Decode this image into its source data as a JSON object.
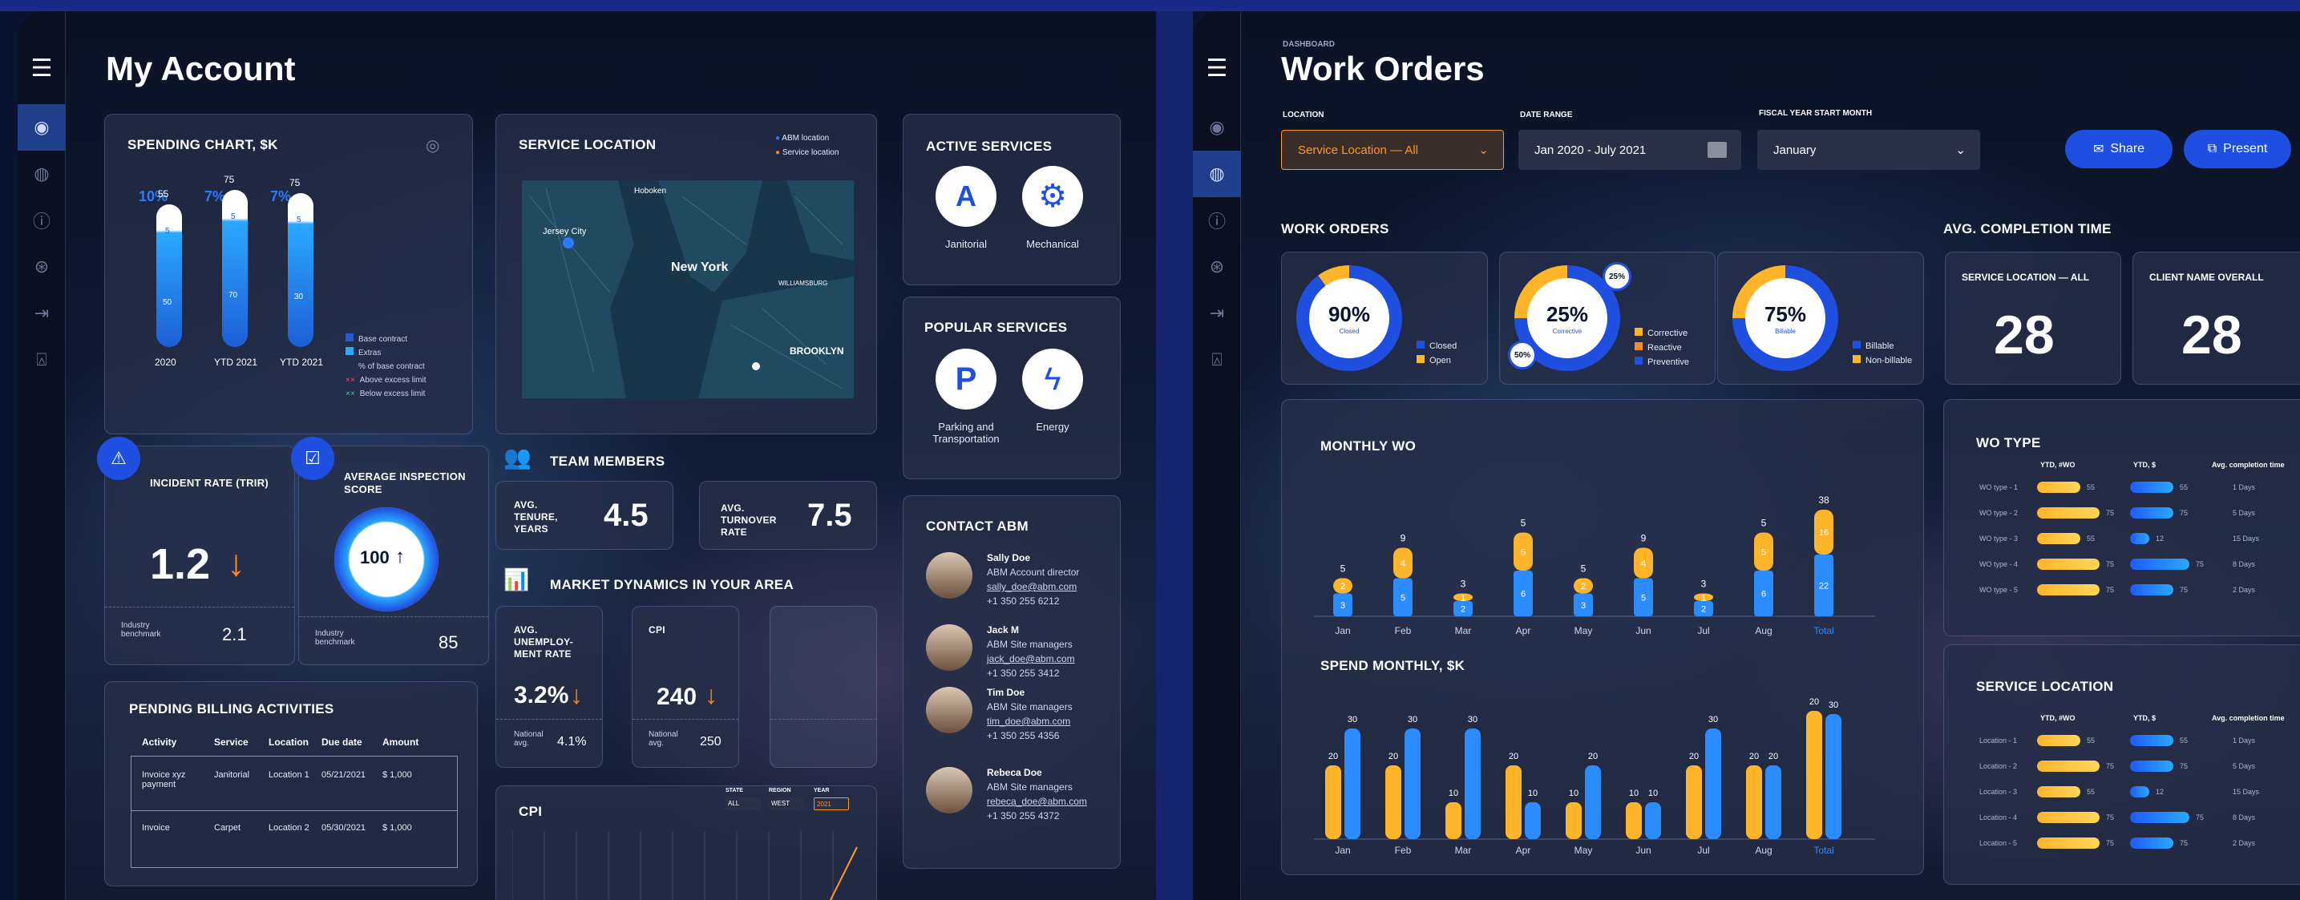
{
  "account": {
    "title": "My Account",
    "spending": {
      "title": "SPENDING CHART, $K",
      "pcts": [
        "10%",
        "7%",
        "7%"
      ],
      "tops": [
        "55",
        "75",
        "75"
      ],
      "inner": [
        [
          "5",
          "50"
        ],
        [
          "5",
          "70"
        ],
        [
          "5",
          "30"
        ]
      ],
      "xs": [
        "2020",
        "YTD 2021",
        "YTD 2021"
      ],
      "legend": [
        "Base contract",
        "Extras",
        "% of base contract",
        "Above excess limit",
        "Below excess limit"
      ]
    },
    "location": {
      "title": "SERVICE LOCATION",
      "legend": [
        "ABM location",
        "Service location"
      ],
      "map": {
        "labels": [
          "Hoboken",
          "Jersey City",
          "New York",
          "BROOKLYN",
          "WILLIAMSBURG"
        ]
      }
    },
    "active": {
      "title": "ACTIVE SERVICES",
      "items": [
        "Janitorial",
        "Mechanical"
      ]
    },
    "popular": {
      "title": "POPULAR SERVICES",
      "items": [
        "Parking and Transportation",
        "Energy"
      ]
    },
    "contact": {
      "title": "CONTACT ABM",
      "people": [
        {
          "name": "Sally Doe",
          "role": "ABM Account director",
          "email": "sally_doe@abm.com",
          "phone": "+1 350 255 6212"
        },
        {
          "name": "Jack M",
          "role": "ABM Site managers",
          "email": "jack_doe@abm.com",
          "phone": "+1 350 255 3412"
        },
        {
          "name": "Tim Doe",
          "role": "ABM Site managers",
          "email": "tim_doe@abm.com",
          "phone": "+1 350 255 4356"
        },
        {
          "name": "Rebeca Doe",
          "role": "ABM Site managers",
          "email": "rebeca_doe@abm.com",
          "phone": "+1 350 255 4372"
        }
      ]
    },
    "incident": {
      "title": "INCIDENT RATE (TRIR)",
      "value": "1.2",
      "bench_label": "Industry benchmark",
      "bench": "2.1"
    },
    "inspection": {
      "title": "AVERAGE INSPECTION SCORE",
      "value": "100",
      "bench_label": "Industry benchmark",
      "bench": "85"
    },
    "team": {
      "title": "TEAM MEMBERS",
      "tenure_label": "AVG. TENURE, YEARS",
      "tenure": "4.5",
      "turnover_label": "AVG. TURNOVER RATE",
      "turnover": "7.5"
    },
    "market": {
      "title": "MARKET DYNAMICS IN YOUR AREA",
      "unemp_label": "AVG. UNEMPLOY-MENT RATE",
      "unemp": "3.2%",
      "unemp_nat_label": "National avg.",
      "unemp_nat": "4.1%",
      "cpi_label": "CPI",
      "cpi": "240",
      "cpi_nat_label": "National avg.",
      "cpi_nat": "250"
    },
    "billing": {
      "title": "PENDING BILLING ACTIVITIES",
      "headers": [
        "Activity",
        "Service",
        "Location",
        "Due date",
        "Amount"
      ],
      "rows": [
        [
          "Invoice xyz payment",
          "Janitorial",
          "Location 1",
          "05/21/2021",
          "$ 1,000"
        ],
        [
          "Invoice",
          "Carpet",
          "Location 2",
          "05/30/2021",
          "$ 1,000"
        ]
      ]
    },
    "cpi_chart": {
      "title": "CPI",
      "filters": [
        {
          "label": "STATE",
          "value": "ALL"
        },
        {
          "label": "REGION",
          "value": "WEST"
        },
        {
          "label": "YEAR",
          "value": "2021"
        }
      ]
    }
  },
  "wo": {
    "eyebrow": "DASHBOARD",
    "title": "Work Orders",
    "filters": {
      "location_label": "LOCATION",
      "location": "Service Location —  All",
      "date_label": "DATE RANGE",
      "date": "Jan 2020 - July 2021",
      "fiscal_label": "FISCAL YEAR START MONTH",
      "fiscal": "January"
    },
    "share": "Share",
    "present": "Present",
    "wo_title": "WORK ORDERS",
    "act_title": "AVG. COMPLETION TIME",
    "donuts": [
      {
        "value": "90%",
        "sub": "Closed",
        "legend": [
          "Closed",
          "Open"
        ]
      },
      {
        "value": "25%",
        "sub": "Corrective",
        "legend": [
          "Corrective",
          "Reactive",
          "Preventive"
        ],
        "badges": [
          "25%",
          "50%"
        ]
      },
      {
        "value": "75%",
        "sub": "Billable",
        "legend": [
          "Billable",
          "Non-billable"
        ]
      }
    ],
    "act": [
      {
        "label": "SERVICE LOCATION — ALL",
        "value": "28"
      },
      {
        "label": "CLIENT NAME OVERALL",
        "value": "28"
      }
    ],
    "monthly": {
      "title": "MONTHLY WO",
      "months": [
        "Jan",
        "Feb",
        "Mar",
        "Apr",
        "May",
        "Jun",
        "Jul",
        "Aug",
        "Total"
      ]
    },
    "spend": {
      "title": "SPEND MONTHLY, $K",
      "months": [
        "Jan",
        "Feb",
        "Mar",
        "Apr",
        "May",
        "Jun",
        "Jul",
        "Aug",
        "Total"
      ]
    },
    "wotype": {
      "title": "WO TYPE",
      "cols": [
        "YTD, #WO",
        "YTD, $",
        "Avg. completion time"
      ],
      "rows": [
        {
          "name": "WO type - 1",
          "a": "55",
          "b": "55",
          "t": "1 Days"
        },
        {
          "name": "WO type - 2",
          "a": "75",
          "b": "75",
          "t": "5 Days"
        },
        {
          "name": "WO type - 3",
          "a": "55",
          "b": "12",
          "t": "15 Days"
        },
        {
          "name": "WO type - 4",
          "a": "75",
          "b": "75",
          "t": "8 Days"
        },
        {
          "name": "WO type - 5",
          "a": "75",
          "b": "75",
          "t": "2 Days"
        }
      ]
    },
    "svcloc": {
      "title": "SERVICE LOCATION",
      "cols": [
        "YTD, #WO",
        "YTD, $",
        "Avg. completion time"
      ],
      "rows": [
        {
          "name": "Location - 1",
          "a": "55",
          "b": "55",
          "t": "1 Days"
        },
        {
          "name": "Location - 2",
          "a": "75",
          "b": "75",
          "t": "5 Days"
        },
        {
          "name": "Location - 3",
          "a": "55",
          "b": "12",
          "t": "15 Days"
        },
        {
          "name": "Location - 4",
          "a": "75",
          "b": "75",
          "t": "8 Days"
        },
        {
          "name": "Location - 5",
          "a": "75",
          "b": "75",
          "t": "2 Days"
        }
      ]
    }
  },
  "chart_data": [
    {
      "type": "bar",
      "title": "MONTHLY WO",
      "categories": [
        "Jan",
        "Feb",
        "Mar",
        "Apr",
        "May",
        "Jun",
        "Jul",
        "Aug",
        "Total"
      ],
      "totals": [
        5,
        9,
        3,
        5,
        5,
        9,
        3,
        5,
        38
      ],
      "series": [
        {
          "values": [
            3,
            5,
            2,
            6,
            3,
            5,
            2,
            6,
            22
          ]
        },
        {
          "values": [
            2,
            4,
            1,
            5,
            2,
            4,
            1,
            5,
            16
          ]
        }
      ]
    },
    {
      "type": "bar",
      "title": "SPEND MONTHLY, $K",
      "categories": [
        "Jan",
        "Feb",
        "Mar",
        "Apr",
        "May",
        "Jun",
        "Jul",
        "Aug",
        "Total"
      ],
      "series": [
        {
          "values": [
            20,
            20,
            10,
            20,
            10,
            10,
            20,
            20,
            20
          ]
        },
        {
          "values": [
            30,
            30,
            30,
            10,
            20,
            10,
            30,
            20,
            30
          ]
        }
      ]
    },
    {
      "type": "bar",
      "title": "SPENDING CHART, $K",
      "categories": [
        "2020",
        "YTD 2021",
        "YTD 2021"
      ],
      "values": [
        55,
        75,
        75
      ]
    }
  ]
}
